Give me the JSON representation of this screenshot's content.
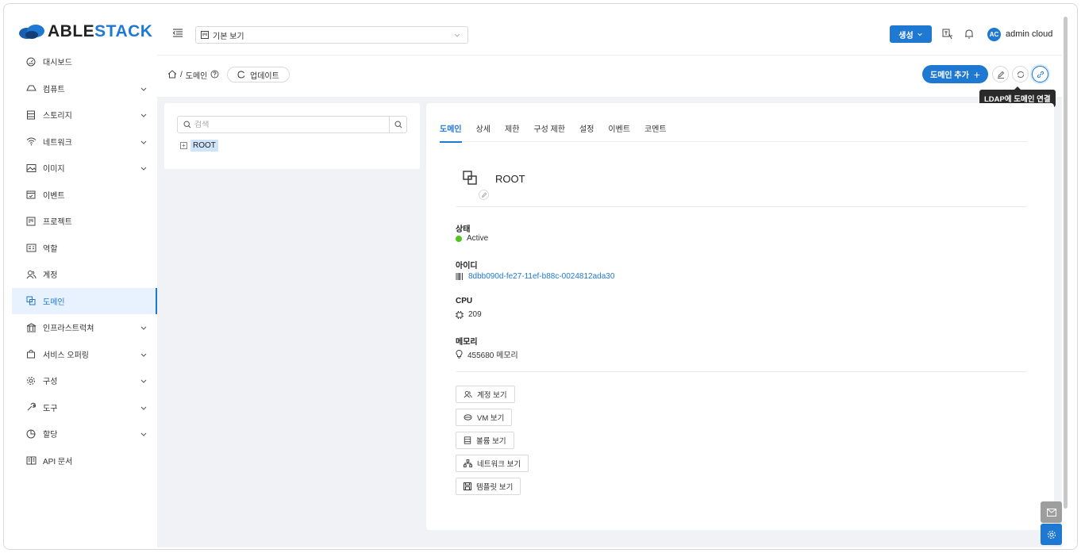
{
  "brand": {
    "part1": "ABLE",
    "part2": "STACK",
    "colors": {
      "primary": "#1f78d1",
      "dark": "#222222"
    }
  },
  "sidebar": {
    "items": [
      {
        "label": "대시보드",
        "icon": "dashboard-icon",
        "submenu": false
      },
      {
        "label": "컴퓨트",
        "icon": "cloud-icon",
        "submenu": true
      },
      {
        "label": "스토리지",
        "icon": "storage-icon",
        "submenu": true
      },
      {
        "label": "네트워크",
        "icon": "wifi-icon",
        "submenu": true
      },
      {
        "label": "이미지",
        "icon": "image-icon",
        "submenu": true
      },
      {
        "label": "이벤트",
        "icon": "calendar-icon",
        "submenu": false
      },
      {
        "label": "프로젝트",
        "icon": "project-icon",
        "submenu": false
      },
      {
        "label": "역할",
        "icon": "idcard-icon",
        "submenu": false
      },
      {
        "label": "계정",
        "icon": "team-icon",
        "submenu": false
      },
      {
        "label": "도메인",
        "icon": "block-icon",
        "submenu": false,
        "active": true
      },
      {
        "label": "인프라스트럭쳐",
        "icon": "bank-icon",
        "submenu": true
      },
      {
        "label": "서비스 오퍼링",
        "icon": "shopping-icon",
        "submenu": true
      },
      {
        "label": "구성",
        "icon": "setting-icon",
        "submenu": true
      },
      {
        "label": "도구",
        "icon": "tool-icon",
        "submenu": true
      },
      {
        "label": "할당",
        "icon": "piechart-icon",
        "submenu": true
      },
      {
        "label": "API 문서",
        "icon": "book-icon",
        "submenu": false
      }
    ]
  },
  "topbar": {
    "view_select": "기본 보기",
    "create_label": "생성",
    "avatar": "AC",
    "username": "admin cloud"
  },
  "breadcrumb": {
    "page": "도메인",
    "update_label": "업데이트",
    "add_domain_label": "도메인 추가",
    "tooltip": "LDAP에 도메인 연결"
  },
  "tree": {
    "search_placeholder": "검색",
    "root_label": "ROOT"
  },
  "detail": {
    "tabs": [
      "도메인",
      "상세",
      "제한",
      "구성 제한",
      "설정",
      "이벤트",
      "코멘트"
    ],
    "active_tab": "도메인",
    "name": "ROOT",
    "state_label": "상태",
    "state_value": "Active",
    "state_color": "#52c41a",
    "id_label": "아이디",
    "id_value": "8dbb090d-fe27-11ef-b88c-0024812ada30",
    "cpu_label": "CPU",
    "cpu_value": "209",
    "memory_label": "메모리",
    "memory_value": "455680 메모리",
    "buttons": [
      "계정 보기",
      "VM 보기",
      "볼륨 보기",
      "네트워크 보기",
      "템플릿 보기"
    ]
  }
}
